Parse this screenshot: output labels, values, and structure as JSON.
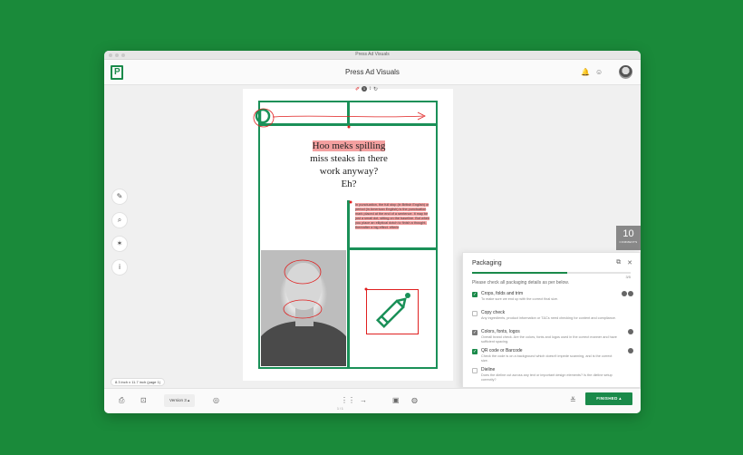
{
  "window": {
    "title": "Press Ad Visuals"
  },
  "header": {
    "title": "Press Ad Visuals",
    "logo_letter": "P",
    "bell_icon": "bell-icon",
    "emoji_icon": "smiley-icon"
  },
  "ad": {
    "headline_highlight": "Hoo meks spilling",
    "headline_rest_1": "miss steaks in there",
    "headline_rest_2": "work anyway?",
    "headline_rest_3": "Eh?",
    "body": "In punctuation, the full stop (in British English) or period (in American English) is the punctuation mark placed at the end of a sentence. It may be just a small dot, sitting on the baseline. But when you place an elliptical dotch to finish a thought, thereafter a big effect. efterle",
    "toolbar_count": "1"
  },
  "comments": {
    "count": "10",
    "label": "COMMENTS"
  },
  "packaging": {
    "title": "Packaging",
    "progress": 0.6,
    "count": "3/5",
    "description": "Please check all packaging details as per below.",
    "items": [
      {
        "title": "Crops, folds and trim",
        "desc": "To make sure we end up with the correct final size.",
        "checked": true
      },
      {
        "title": "Copy check",
        "desc": "Any ingredients, product information or T&Cs need checking for content and compliance.",
        "checked": false
      },
      {
        "title": "Colors, fonts, logos",
        "desc": "Overall brand check. Are the colors, fonts and logos used in the correct manner and have sufficient spacing.",
        "checked": true
      },
      {
        "title": "QR code or Barcode",
        "desc": "Check the code is on a background which doesn't impede scanning, and is the correct size.",
        "checked": true
      },
      {
        "title": "Dieline",
        "desc": "Does the dieline cut across any text or important design elements? Is the dieline setup correctly?",
        "checked": false
      }
    ]
  },
  "bottom": {
    "version": "Version 3",
    "page": "1 / 1",
    "finished": "FINISHED",
    "size": "8.3 inch x 11.7 inch (page 1)"
  },
  "colors": {
    "brand": "#1a8a4a",
    "background": "#1a8a3a",
    "highlight": "#f4a0a0",
    "annotation": "#e02020"
  }
}
